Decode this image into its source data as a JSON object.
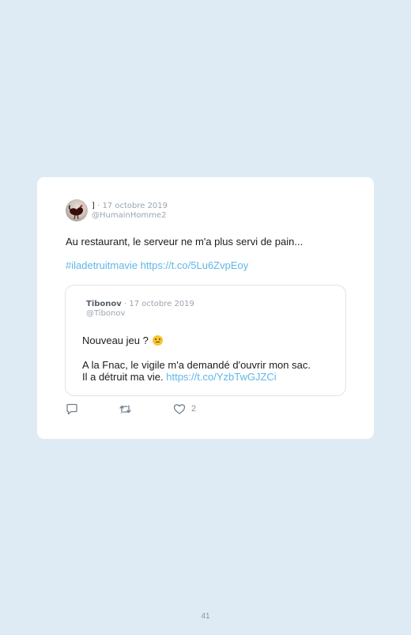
{
  "tweet": {
    "author_name": "]",
    "date": " · 17 octobre 2019",
    "handle": "@HumainHomme2",
    "text": "Au restaurant, le serveur ne m'a plus servi de pain...",
    "hashtag": "#iladetruitmavie",
    "link": "https://t.co/5Lu6ZvpEoy"
  },
  "quoted_tweet": {
    "author_name": "Tibonov",
    "date": " · 17 octobre 2019",
    "handle": "@Tibonov",
    "line1": "Nouveau jeu ?",
    "emoji_icon": "winking-face-icon",
    "line2": "A la Fnac, le vigile m'a demandé d'ouvrir mon sac.",
    "line3": "Il a détruit ma vie.",
    "link": "https://t.co/YzbTwGJZCi"
  },
  "actions": {
    "reply_icon": "reply-icon",
    "retweet_icon": "retweet-icon",
    "like_icon": "heart-icon",
    "like_count": "2"
  },
  "page_number": "41",
  "colors": {
    "background": "#deebf4",
    "card": "#ffffff",
    "link": "#5fb7e6",
    "muted": "#9aa5b0"
  }
}
